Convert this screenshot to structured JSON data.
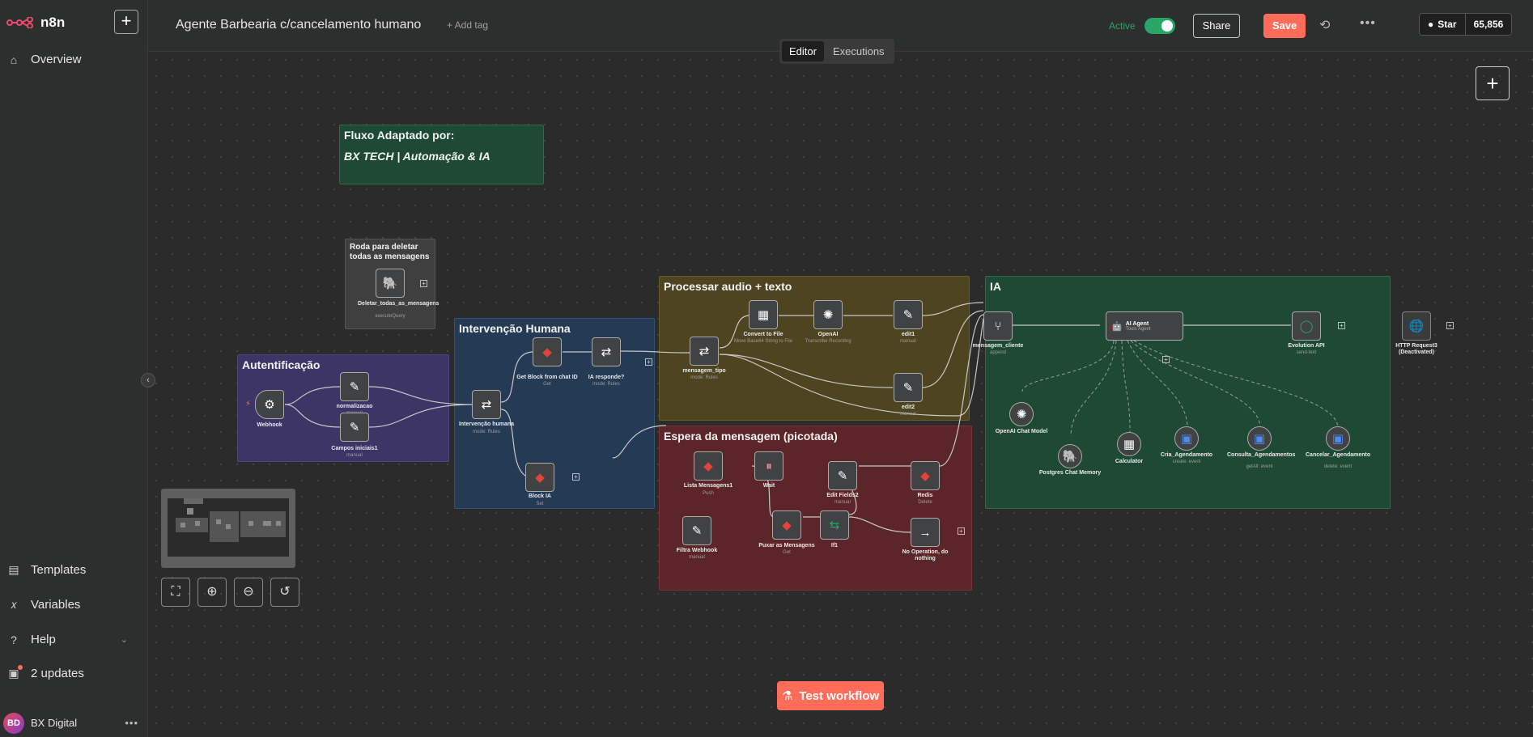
{
  "app": {
    "brand": "n8n"
  },
  "sidebar": {
    "plus_label": "+",
    "collapse_icon": "‹",
    "items": [
      {
        "label": "Overview",
        "icon": "home-icon"
      },
      {
        "label": "Templates",
        "icon": "templates-icon"
      },
      {
        "label": "Variables",
        "icon": "variables-icon"
      },
      {
        "label": "Help",
        "icon": "help-icon"
      },
      {
        "label": "2 updates",
        "icon": "gift-icon"
      }
    ],
    "user": {
      "initials": "BD",
      "name": "BX Digital"
    }
  },
  "header": {
    "workflow_name": "Agente Barbearia c/cancelamento humano",
    "add_tag": "+ Add tag",
    "active_label": "Active",
    "active": true,
    "share": "Share",
    "save": "Save",
    "github_star": "Star",
    "github_count": "65,856"
  },
  "tabs": [
    "Editor",
    "Executions"
  ],
  "canvas": {
    "stickies": {
      "fluxo_l1": "Fluxo Adaptado por:",
      "fluxo_l2": "BX TECH | Automação & IA",
      "roda_l1": "Roda para deletar",
      "roda_l2": "todas as mensagens",
      "autentificacao": "Autentificação",
      "intervencao": "Intervenção Humana",
      "processar": "Processar audio + texto",
      "espera": "Espera da mensagem (picotada)",
      "ia": "IA"
    },
    "nodes": [
      {
        "id": "deletar",
        "label": "Deletar_todas_as_mensagens",
        "sub": "executeQuery"
      },
      {
        "id": "webhook",
        "label": "Webhook",
        "sub": ""
      },
      {
        "id": "normalizacao",
        "label": "normalizacao",
        "sub": "manual"
      },
      {
        "id": "campos",
        "label": "Campos iniciais1",
        "sub": "manual"
      },
      {
        "id": "intervencao",
        "label": "Intervenção humana",
        "sub": "mode: Rules"
      },
      {
        "id": "getblock",
        "label": "Get Block from chat ID",
        "sub": "Get"
      },
      {
        "id": "iaresponde",
        "label": "IA responde?",
        "sub": "mode: Rules"
      },
      {
        "id": "blockia",
        "label": "Block IA",
        "sub": "Set"
      },
      {
        "id": "mensagem_tipo",
        "label": "mensagem_tipo",
        "sub": "mode: Rules"
      },
      {
        "id": "convert",
        "label": "Convert to File",
        "sub": "Move Base64 String to File"
      },
      {
        "id": "openai",
        "label": "OpenAI",
        "sub": "Transcribe Recording"
      },
      {
        "id": "edit1",
        "label": "edit1",
        "sub": "manual"
      },
      {
        "id": "edit2",
        "label": "edit2",
        "sub": "manual"
      },
      {
        "id": "lista",
        "label": "Lista Mensagens1",
        "sub": "Push"
      },
      {
        "id": "wait",
        "label": "Wait",
        "sub": ""
      },
      {
        "id": "editfields2",
        "label": "Edit Fields2",
        "sub": "manual"
      },
      {
        "id": "redis",
        "label": "Redis",
        "sub": "Delete"
      },
      {
        "id": "filtra",
        "label": "Filtra Webhook",
        "sub": "manual"
      },
      {
        "id": "puxar",
        "label": "Puxar as Mensagens",
        "sub": "Get"
      },
      {
        "id": "if1",
        "label": "If1",
        "sub": ""
      },
      {
        "id": "noop",
        "label": "No Operation, do nothing",
        "sub": ""
      },
      {
        "id": "mensagem_cliente",
        "label": "mensagem_cliente",
        "sub": "append"
      },
      {
        "id": "aiagent",
        "label": "AI Agent",
        "sub": "Tools Agent"
      },
      {
        "id": "evolution",
        "label": "Evolution API",
        "sub": "send-text"
      },
      {
        "id": "http",
        "label": "HTTP Request3 (Deactivated)",
        "sub": ""
      },
      {
        "id": "openaichat",
        "label": "OpenAI Chat Model",
        "sub": ""
      },
      {
        "id": "postgres",
        "label": "Postgres Chat Memory",
        "sub": ""
      },
      {
        "id": "calculator",
        "label": "Calculator",
        "sub": ""
      },
      {
        "id": "cria",
        "label": "Cria_Agendamento",
        "sub": "create: event"
      },
      {
        "id": "consulta",
        "label": "Consulta_Agendamentos",
        "sub": "getAll: event"
      },
      {
        "id": "cancelar",
        "label": "Cancelar_Agendamento",
        "sub": "delete: event"
      }
    ]
  },
  "test_workflow": "Test workflow",
  "colors": {
    "accent": "#ff6d5a",
    "active": "#29a568"
  }
}
